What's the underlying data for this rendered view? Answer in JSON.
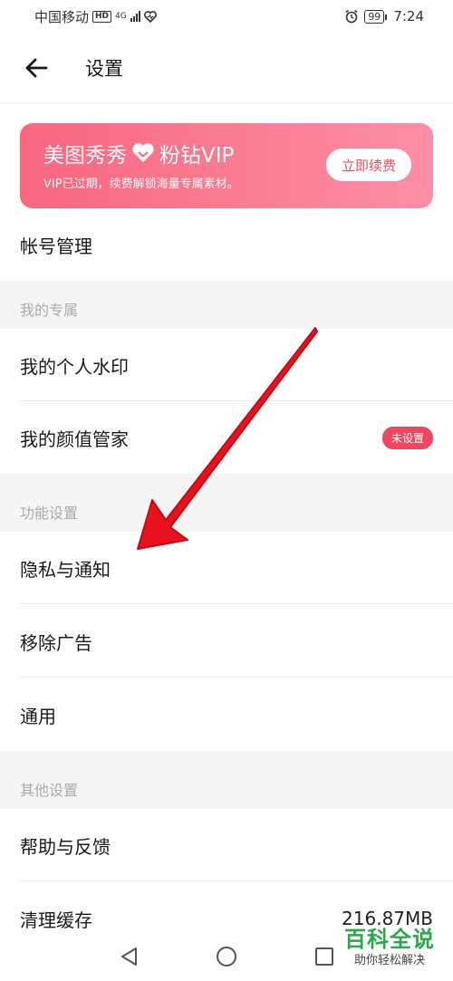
{
  "status_bar": {
    "carrier": "中国移动",
    "hd": "HD",
    "network": "4G",
    "battery": "99",
    "time": "7:24"
  },
  "header": {
    "title": "设置",
    "back_icon": "arrow-left-icon"
  },
  "vip_banner": {
    "title_left": "美图秀秀",
    "title_right": "粉钻VIP",
    "subtitle": "VIP已过期，续费解锁海量专属素材。",
    "button_label": "立即续费",
    "colors": {
      "gradient_start": "#f9667f",
      "gradient_end": "#fd8fa6",
      "button_text": "#f04a6a"
    }
  },
  "account": {
    "label": "帐号管理"
  },
  "sections": {
    "my_exclusive": {
      "title": "我的专属",
      "items": [
        {
          "label": "我的个人水印"
        },
        {
          "label": "我的颜值管家",
          "badge": "未设置"
        }
      ]
    },
    "features": {
      "title": "功能设置",
      "items": [
        {
          "label": "隐私与通知"
        },
        {
          "label": "移除广告"
        },
        {
          "label": "通用"
        }
      ]
    },
    "other": {
      "title": "其他设置",
      "items": [
        {
          "label": "帮助与反馈"
        },
        {
          "label": "清理缓存",
          "value": "216.87MB"
        }
      ]
    }
  },
  "nav_bar": {
    "back": "triangle-back-icon",
    "home": "circle-home-icon",
    "recents": "square-recents-icon"
  },
  "watermark": {
    "title": "百科全说",
    "subtitle": "助你轻松解决"
  },
  "accent_colors": {
    "badge": "#f0465f",
    "arrow": "#e8111d",
    "watermark_green": "#2aa84a"
  }
}
